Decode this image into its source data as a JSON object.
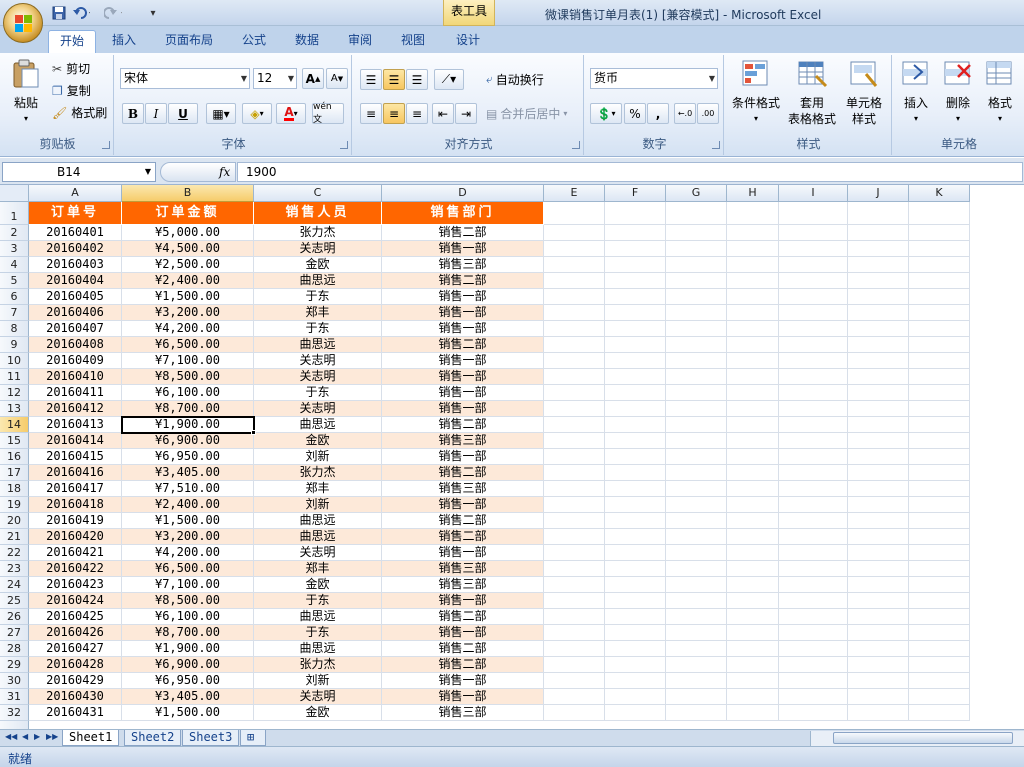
{
  "window": {
    "title": "微课销售订单月表(1)  [兼容模式] - Microsoft Excel",
    "context_tab": "表工具"
  },
  "quick_access": {
    "icons": [
      "save-icon",
      "undo-icon",
      "redo-icon",
      "customize-icon"
    ]
  },
  "tabs": [
    "开始",
    "插入",
    "页面布局",
    "公式",
    "数据",
    "审阅",
    "视图",
    "设计"
  ],
  "active_tab": "开始",
  "ribbon": {
    "clipboard": {
      "label": "剪贴板",
      "paste": "粘贴",
      "cut": "剪切",
      "copy": "复制",
      "format_painter": "格式刷"
    },
    "font": {
      "label": "字体",
      "name": "宋体",
      "size": "12",
      "bold": "B",
      "italic": "I",
      "underline": "U",
      "grow": "A",
      "shrink": "A",
      "phonetic": "wén 文"
    },
    "alignment": {
      "label": "对齐方式",
      "wrap_text": "自动换行",
      "merge_center": "合并后居中"
    },
    "number": {
      "label": "数字",
      "format": "货币",
      "percent": "%",
      "comma": ","
    },
    "styles": {
      "label": "样式",
      "conditional": "条件格式",
      "table_line1": "套用",
      "table_line2": "表格格式",
      "cell_line1": "单元格",
      "cell_line2": "样式"
    },
    "cells": {
      "label": "单元格",
      "insert": "插入",
      "delete": "删除",
      "format": "格式"
    }
  },
  "formula_bar": {
    "name_box": "B14",
    "fx": "fx",
    "value": "1900"
  },
  "columns": [
    "A",
    "B",
    "C",
    "D",
    "E",
    "F",
    "G",
    "H",
    "I",
    "J",
    "K"
  ],
  "selected_column": "B",
  "selected_row": "14",
  "headers": [
    "订单号",
    "订单金额",
    "销售人员",
    "销售部门"
  ],
  "rows": [
    {
      "r": "2",
      "id": "20160401",
      "amount": "¥5,000.00",
      "person": "张力杰",
      "dept": "销售二部"
    },
    {
      "r": "3",
      "id": "20160402",
      "amount": "¥4,500.00",
      "person": "关志明",
      "dept": "销售一部"
    },
    {
      "r": "4",
      "id": "20160403",
      "amount": "¥2,500.00",
      "person": "金欧",
      "dept": "销售三部"
    },
    {
      "r": "5",
      "id": "20160404",
      "amount": "¥2,400.00",
      "person": "曲思远",
      "dept": "销售二部"
    },
    {
      "r": "6",
      "id": "20160405",
      "amount": "¥1,500.00",
      "person": "于东",
      "dept": "销售一部"
    },
    {
      "r": "7",
      "id": "20160406",
      "amount": "¥3,200.00",
      "person": "郑丰",
      "dept": "销售一部"
    },
    {
      "r": "8",
      "id": "20160407",
      "amount": "¥4,200.00",
      "person": "于东",
      "dept": "销售一部"
    },
    {
      "r": "9",
      "id": "20160408",
      "amount": "¥6,500.00",
      "person": "曲思远",
      "dept": "销售二部"
    },
    {
      "r": "10",
      "id": "20160409",
      "amount": "¥7,100.00",
      "person": "关志明",
      "dept": "销售一部"
    },
    {
      "r": "11",
      "id": "20160410",
      "amount": "¥8,500.00",
      "person": "关志明",
      "dept": "销售一部"
    },
    {
      "r": "12",
      "id": "20160411",
      "amount": "¥6,100.00",
      "person": "于东",
      "dept": "销售一部"
    },
    {
      "r": "13",
      "id": "20160412",
      "amount": "¥8,700.00",
      "person": "关志明",
      "dept": "销售一部"
    },
    {
      "r": "14",
      "id": "20160413",
      "amount": "¥1,900.00",
      "person": "曲思远",
      "dept": "销售二部"
    },
    {
      "r": "15",
      "id": "20160414",
      "amount": "¥6,900.00",
      "person": "金欧",
      "dept": "销售三部"
    },
    {
      "r": "16",
      "id": "20160415",
      "amount": "¥6,950.00",
      "person": "刘新",
      "dept": "销售一部"
    },
    {
      "r": "17",
      "id": "20160416",
      "amount": "¥3,405.00",
      "person": "张力杰",
      "dept": "销售二部"
    },
    {
      "r": "18",
      "id": "20160417",
      "amount": "¥7,510.00",
      "person": "郑丰",
      "dept": "销售三部"
    },
    {
      "r": "19",
      "id": "20160418",
      "amount": "¥2,400.00",
      "person": "刘新",
      "dept": "销售一部"
    },
    {
      "r": "20",
      "id": "20160419",
      "amount": "¥1,500.00",
      "person": "曲思远",
      "dept": "销售二部"
    },
    {
      "r": "21",
      "id": "20160420",
      "amount": "¥3,200.00",
      "person": "曲思远",
      "dept": "销售二部"
    },
    {
      "r": "22",
      "id": "20160421",
      "amount": "¥4,200.00",
      "person": "关志明",
      "dept": "销售一部"
    },
    {
      "r": "23",
      "id": "20160422",
      "amount": "¥6,500.00",
      "person": "郑丰",
      "dept": "销售三部"
    },
    {
      "r": "24",
      "id": "20160423",
      "amount": "¥7,100.00",
      "person": "金欧",
      "dept": "销售三部"
    },
    {
      "r": "25",
      "id": "20160424",
      "amount": "¥8,500.00",
      "person": "于东",
      "dept": "销售一部"
    },
    {
      "r": "26",
      "id": "20160425",
      "amount": "¥6,100.00",
      "person": "曲思远",
      "dept": "销售二部"
    },
    {
      "r": "27",
      "id": "20160426",
      "amount": "¥8,700.00",
      "person": "于东",
      "dept": "销售一部"
    },
    {
      "r": "28",
      "id": "20160427",
      "amount": "¥1,900.00",
      "person": "曲思远",
      "dept": "销售二部"
    },
    {
      "r": "29",
      "id": "20160428",
      "amount": "¥6,900.00",
      "person": "张力杰",
      "dept": "销售二部"
    },
    {
      "r": "30",
      "id": "20160429",
      "amount": "¥6,950.00",
      "person": "刘新",
      "dept": "销售一部"
    },
    {
      "r": "31",
      "id": "20160430",
      "amount": "¥3,405.00",
      "person": "关志明",
      "dept": "销售一部"
    },
    {
      "r": "32",
      "id": "20160431",
      "amount": "¥1,500.00",
      "person": "金欧",
      "dept": "销售三部"
    }
  ],
  "colors": {
    "header_fill": "#ff6600",
    "stripe_fill": "#fde9d9",
    "header_text": "#ffffff"
  },
  "sheets": [
    "Sheet1",
    "Sheet2",
    "Sheet3"
  ],
  "active_sheet": "Sheet1",
  "status": "就绪"
}
